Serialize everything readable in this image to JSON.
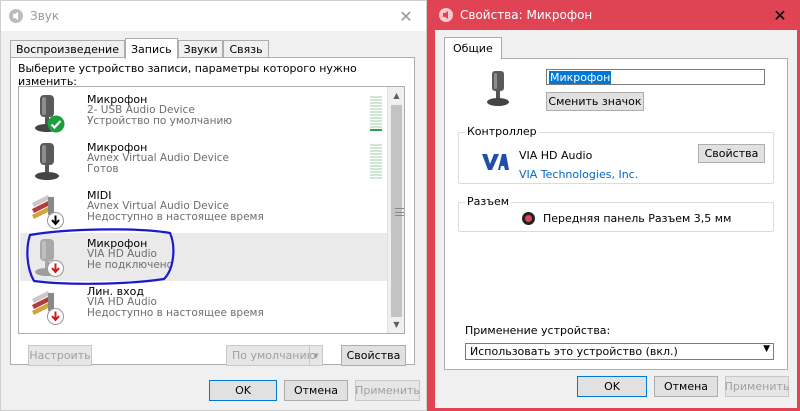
{
  "left_window": {
    "title": "Звук",
    "tabs": [
      {
        "label": "Воспроизведение",
        "active": false
      },
      {
        "label": "Запись",
        "active": true
      },
      {
        "label": "Звуки",
        "active": false
      },
      {
        "label": "Связь",
        "active": false
      }
    ],
    "instruction": "Выберите устройство записи, параметры которого нужно изменить:",
    "devices": [
      {
        "name": "Микрофон",
        "line1": "2- USB Audio Device",
        "line2": "Устройство по умолчанию",
        "icon": "microphone-icon",
        "badge": "green-check"
      },
      {
        "name": "Микрофон",
        "line1": "Avnex Virtual Audio Device",
        "line2": "Готов",
        "icon": "microphone-icon",
        "badge": "none"
      },
      {
        "name": "MIDI",
        "line1": "Avnex Virtual Audio Device",
        "line2": "Недоступно в настоящее время",
        "icon": "rca-cable-icon",
        "badge": "black-down-arrow"
      },
      {
        "name": "Микрофон",
        "line1": "VIA HD Audio",
        "line2": "Не подключено",
        "icon": "microphone-icon",
        "badge": "red-down-arrow",
        "selected": true
      },
      {
        "name": "Лин. вход",
        "line1": "VIA HD Audio",
        "line2": "Недоступно в настоящее время",
        "icon": "rca-cable-icon",
        "badge": "red-down-arrow"
      }
    ],
    "buttons": {
      "configure": "Настроить",
      "set_default": "По умолчанию",
      "properties": "Свойства",
      "ok": "OK",
      "cancel": "Отмена",
      "apply": "Применить"
    },
    "colors": {
      "annotation": "#1a1acc",
      "check": "#1e9e3e",
      "red_badge": "#d01818"
    }
  },
  "right_window": {
    "title": "Свойства: Микрофон",
    "tab": "Общие",
    "name_value": "Микрофон",
    "change_icon": "Сменить значок",
    "controller": {
      "label": "Контроллер",
      "device": "VIA HD Audio",
      "vendor": "VIA Technologies, Inc.",
      "properties": "Свойства"
    },
    "jack": {
      "label": "Разъем",
      "description": "Передняя панель Разъем 3,5 мм"
    },
    "usage": {
      "label": "Применение устройства:",
      "selected": "Использовать это устройство (вкл.)"
    },
    "buttons": {
      "ok": "OK",
      "cancel": "Отмена",
      "apply": "Применить"
    },
    "colors": {
      "accent": "#e04454",
      "selection": "#0078d7"
    }
  }
}
